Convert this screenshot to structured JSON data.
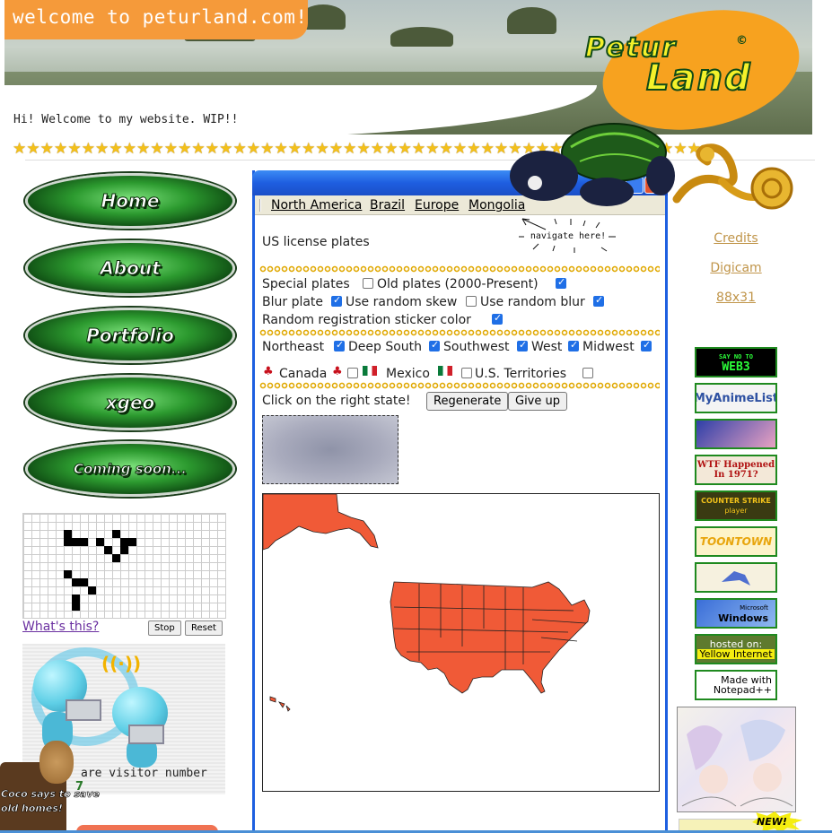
{
  "header": {
    "banner": "welcome to peturland.com!",
    "logo_line1": "Petur",
    "logo_line2": "Land",
    "logo_copyright": "©",
    "welcome_text": "Hi! Welcome to my website. WIP!!",
    "stars": "★★★★★★★★★★★★★★★★★★★★★★★★★★★★★★★★★★★★★★★★★★★★★★★★★★"
  },
  "nav": {
    "items": [
      {
        "label": "Home"
      },
      {
        "label": "About"
      },
      {
        "label": "Portfolio"
      },
      {
        "label": "xgeo"
      },
      {
        "label": "Coming soon..."
      }
    ]
  },
  "life": {
    "link": "What's this?",
    "stop": "Stop",
    "reset": "Reset"
  },
  "visitor": {
    "text": "are visitor number",
    "number": "7",
    "coco_line1": "Coco says to save",
    "coco_line2": "old homes!"
  },
  "window": {
    "menu": [
      "North America",
      "Brazil",
      "Europe",
      "Mongolia"
    ],
    "navigate_hint": "navigate here!",
    "heading": "US license plates",
    "options": {
      "special_plates": {
        "label": "Special plates",
        "checked": false
      },
      "old_plates": {
        "label": "Old plates (2000-Present)",
        "checked": true
      },
      "blur_plate": {
        "label": "Blur plate",
        "checked": true
      },
      "random_skew": {
        "label": "Use random skew",
        "checked": false
      },
      "random_blur": {
        "label": "Use random blur",
        "checked": true
      },
      "sticker_color": {
        "label": "Random registration sticker color",
        "checked": true
      }
    },
    "regions": {
      "northeast": {
        "label": "Northeast",
        "checked": true
      },
      "deep_south": {
        "label": "Deep South",
        "checked": true
      },
      "southwest": {
        "label": "Southwest",
        "checked": true
      },
      "west": {
        "label": "West",
        "checked": true
      },
      "midwest": {
        "label": "Midwest",
        "checked": true
      },
      "canada": {
        "label": "Canada",
        "checked": false
      },
      "mexico": {
        "label": "Mexico",
        "checked": false
      },
      "territories": {
        "label": "U.S. Territories",
        "checked": false
      }
    },
    "prompt": "Click on the right state!",
    "regenerate": "Regenerate",
    "give_up": "Give up",
    "map_color": "#f05a37"
  },
  "right": {
    "links": [
      "Credits",
      "Digicam",
      "88x31"
    ],
    "badges": [
      {
        "name": "web3",
        "l1": "SAY NO TO",
        "l2": "WEB3"
      },
      {
        "name": "myanimelist",
        "l1": "MyAnimeList",
        "l2": ""
      },
      {
        "name": "anime-girl",
        "l1": "",
        "l2": ""
      },
      {
        "name": "wtf-1971",
        "l1": "WTF Happened In 1971?",
        "l2": ""
      },
      {
        "name": "counter-strike",
        "l1": "COUNTER STRIKE",
        "l2": "player"
      },
      {
        "name": "toontown",
        "l1": "TOONTOWN",
        "l2": ""
      },
      {
        "name": "latios",
        "l1": "",
        "l2": ""
      },
      {
        "name": "windows",
        "l1": "Microsoft",
        "l2": "Windows"
      },
      {
        "name": "yellow-internet",
        "l1": "hosted on:",
        "l2": "Yellow Internet"
      },
      {
        "name": "notepad",
        "l1": "Made with",
        "l2": "Notepad++"
      }
    ],
    "new_label": "NEW!"
  }
}
